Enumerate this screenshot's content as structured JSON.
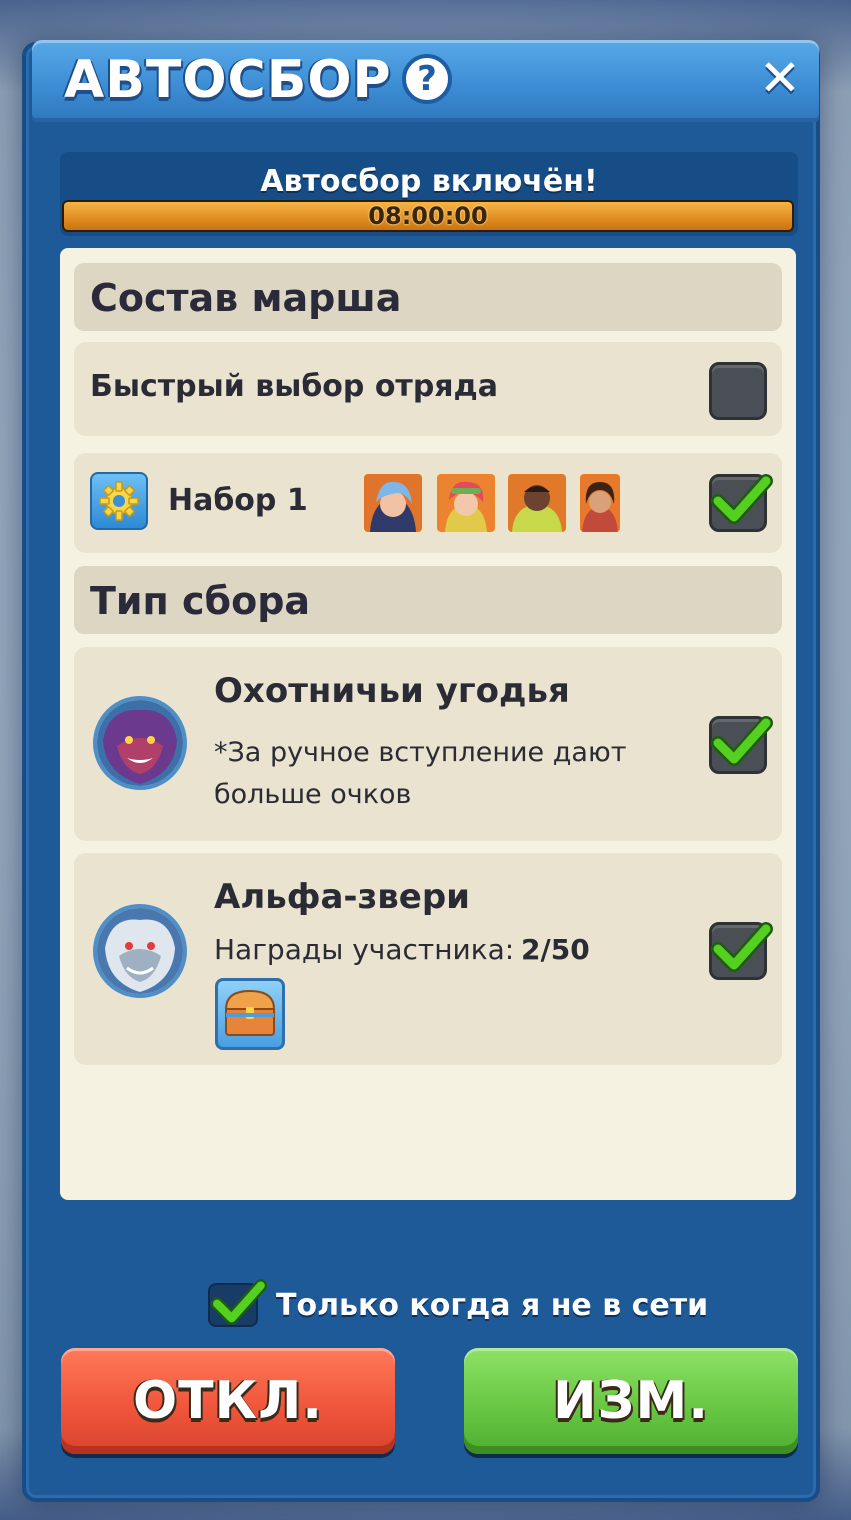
{
  "header": {
    "title": "АВТОСБОР",
    "help_icon": "?",
    "close_icon": "✕"
  },
  "status": {
    "message": "Автосбор включён!",
    "timer": "08:00:00",
    "progress": 1.0
  },
  "march": {
    "section_title": "Состав марша",
    "quick_select_label": "Быстрый выбор отряда",
    "quick_select_checked": false,
    "preset_label": "Набор 1",
    "preset_checked": true,
    "hero_count": 4
  },
  "gather_type": {
    "section_title": "Тип сбора",
    "options": [
      {
        "title": "Охотничьи угодья",
        "note_line1": "*За ручное вступление дают",
        "note_line2": "больше очков",
        "checked": true
      },
      {
        "title": "Альфа-звери",
        "rewards_label": "Награды участника:",
        "rewards_value": "2/50",
        "checked": true
      }
    ]
  },
  "offline_only": {
    "label": "Только когда я не в сети",
    "checked": true
  },
  "buttons": {
    "disable_label": "ОТКЛ.",
    "edit_label": "ИЗМ."
  },
  "colors": {
    "frame": "#1e5a98",
    "title_bar": "#3b8bd3",
    "panel": "#f6f2e2",
    "section_header": "#ddd6c2",
    "check_green": "#4cc21f",
    "disable_button": "#f0563c",
    "edit_button": "#69c744",
    "progress": "#e08c1f"
  }
}
